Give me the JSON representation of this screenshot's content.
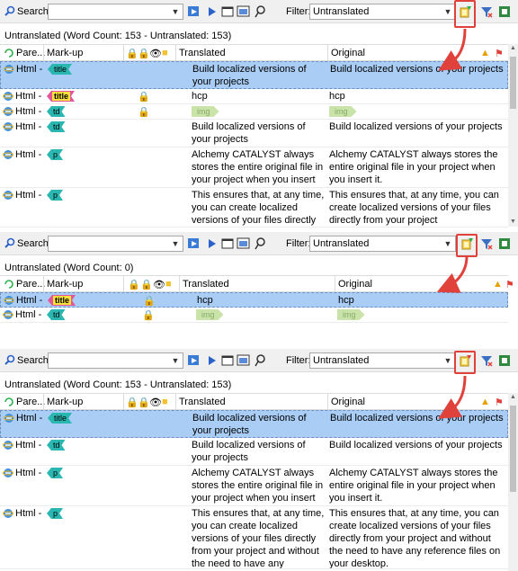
{
  "panels": [
    {
      "search_label": "Search:",
      "search_value": "",
      "filter_label": "Filter:",
      "filter_value": "Untranslated",
      "status": "Untranslated (Word Count: 153 - Untranslated: 153)",
      "headers": {
        "parent": "Pare...",
        "markup": "Mark-up",
        "translated": "Translated",
        "original": "Original"
      },
      "rows": [
        {
          "parent": "Html -",
          "tag": "title",
          "tag_color": "teal",
          "lock": false,
          "translated": "Build localized versions of your projects",
          "original": "Build localized versions of your projects",
          "selected": true
        },
        {
          "parent": "Html -",
          "tag": "title",
          "tag_color": "pink",
          "lock": true,
          "translated": "hcp",
          "original": "hcp",
          "selected": false
        },
        {
          "parent": "Html -",
          "tag": "td",
          "tag_color": "teal",
          "lock": true,
          "translated": "img",
          "original": "img",
          "pill": true,
          "selected": false
        },
        {
          "parent": "Html -",
          "tag": "td",
          "tag_color": "teal",
          "lock": false,
          "translated": "Build localized versions of your projects",
          "original": "Build localized versions of your projects",
          "selected": false
        },
        {
          "parent": "Html -",
          "tag": "p",
          "tag_color": "teal",
          "lock": false,
          "translated": "Alchemy CATALYST always stores the entire original file in your project when you insert it.",
          "original": "Alchemy CATALYST always stores the entire original file in your project when you insert it.",
          "selected": false
        },
        {
          "parent": "Html -",
          "tag": "p",
          "tag_color": "teal",
          "lock": false,
          "translated": "This ensures that, at any time, you can create localized versions of your files directly",
          "original": "This ensures that, at any time, you can create localized versions of your files directly from your project",
          "selected": false
        }
      ]
    },
    {
      "search_label": "Search:",
      "search_value": "",
      "filter_label": "Filter:",
      "filter_value": "Untranslated",
      "status": "Untranslated (Word Count: 0)",
      "headers": {
        "parent": "Pare...",
        "markup": "Mark-up",
        "translated": "Translated",
        "original": "Original"
      },
      "rows": [
        {
          "parent": "Html -",
          "tag": "title",
          "tag_color": "pink",
          "lock": true,
          "translated": "hcp",
          "original": "hcp",
          "selected": true
        },
        {
          "parent": "Html -",
          "tag": "td",
          "tag_color": "teal",
          "lock": true,
          "translated": "img",
          "original": "img",
          "pill": true,
          "selected": false
        }
      ]
    },
    {
      "search_label": "Search:",
      "search_value": "",
      "filter_label": "Filter:",
      "filter_value": "Untranslated",
      "status": "Untranslated (Word Count: 153 - Untranslated: 153)",
      "headers": {
        "parent": "Pare...",
        "markup": "Mark-up",
        "translated": "Translated",
        "original": "Original"
      },
      "rows": [
        {
          "parent": "Html -",
          "tag": "title",
          "tag_color": "teal",
          "lock": false,
          "translated": "Build localized versions of your projects",
          "original": "Build localized versions of your projects",
          "selected": true
        },
        {
          "parent": "Html -",
          "tag": "td",
          "tag_color": "teal",
          "lock": false,
          "translated": "Build localized versions of your projects",
          "original": "Build localized versions of your projects",
          "selected": false
        },
        {
          "parent": "Html -",
          "tag": "p",
          "tag_color": "teal",
          "lock": false,
          "translated": "Alchemy CATALYST always stores the entire original file in your project when you insert it.",
          "original": "Alchemy CATALYST always stores the entire original file in your project when you insert it.",
          "selected": false
        },
        {
          "parent": "Html -",
          "tag": "p",
          "tag_color": "teal",
          "lock": false,
          "translated": "This ensures that, at any time, you can create localized versions of your files directly from your project and without the need to have any reference files on your desktop.",
          "original": "This ensures that, at any time, you can create localized versions of your files directly from your project and without the need to have any reference files on your desktop.",
          "selected": false
        }
      ]
    }
  ],
  "colors": {
    "accent_red": "#e0423b",
    "selection": "#a9cdf4",
    "tag_teal": "#2bb7b1",
    "tag_pink": "#e1559a"
  },
  "icons": [
    "search-icon",
    "refresh-icon",
    "play-icon",
    "window-icon",
    "preview-icon",
    "key-icon",
    "filter-toggle-icon",
    "filter-funnel-icon",
    "excel-icon",
    "ie-icon",
    "lock-icon",
    "eye-icon",
    "folder-icon",
    "warning-icon",
    "flag-icon"
  ]
}
